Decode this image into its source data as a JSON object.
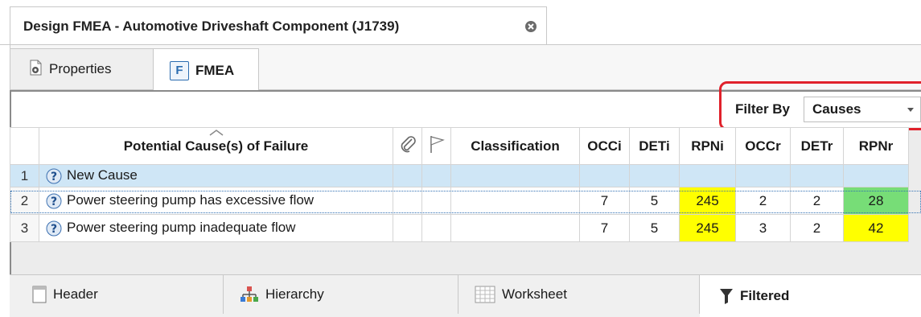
{
  "document_tab": {
    "title": "Design FMEA - Automotive Driveshaft Component (J1739)"
  },
  "sub_tabs": {
    "properties": "Properties",
    "fmea": "FMEA",
    "fmea_badge": "F"
  },
  "filter": {
    "label": "Filter By",
    "value": "Causes"
  },
  "grid": {
    "columns": {
      "cause": "Potential Cause(s) of Failure",
      "classification": "Classification",
      "occi": "OCCi",
      "deti": "DETi",
      "rpni": "RPNi",
      "occr": "OCCr",
      "detr": "DETr",
      "rpnr": "RPNr"
    },
    "rows": [
      {
        "n": "1",
        "cause": "New Cause",
        "occi": "",
        "deti": "",
        "rpni": "",
        "occr": "",
        "detr": "",
        "rpnr": ""
      },
      {
        "n": "2",
        "cause": "Power steering pump has excessive flow",
        "occi": "7",
        "deti": "5",
        "rpni": "245",
        "occr": "2",
        "detr": "2",
        "rpnr": "28"
      },
      {
        "n": "3",
        "cause": "Power steering pump inadequate flow",
        "occi": "7",
        "deti": "5",
        "rpni": "245",
        "occr": "3",
        "detr": "2",
        "rpnr": "42"
      }
    ]
  },
  "bottom_tabs": {
    "header": "Header",
    "hierarchy": "Hierarchy",
    "worksheet": "Worksheet",
    "filtered": "Filtered"
  },
  "colors": {
    "rpn_high": "#ffff00",
    "rpn_low": "#77dd77",
    "selection": "#cfe6f6",
    "highlight": "#e0212b"
  }
}
